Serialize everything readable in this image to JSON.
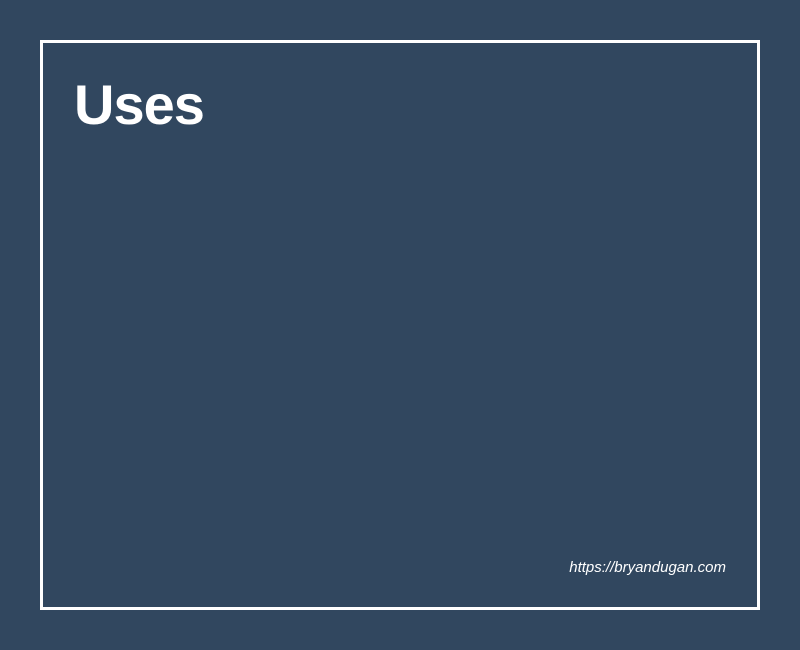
{
  "card": {
    "title": "Uses",
    "url": "https://bryandugan.com"
  },
  "colors": {
    "background": "#31475f",
    "border": "#ffffff",
    "text": "#ffffff"
  }
}
